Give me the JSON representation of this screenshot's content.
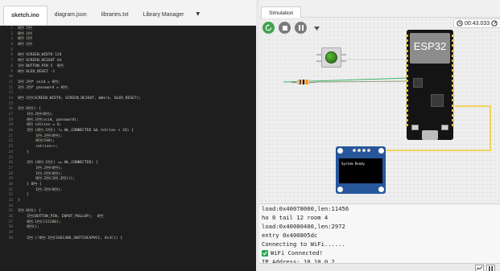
{
  "editor": {
    "tabs": [
      {
        "label": "sketch.ino",
        "active": true
      },
      {
        "label": "diagram.json",
        "active": false
      },
      {
        "label": "libraries.txt",
        "active": false
      },
      {
        "label": "Library Manager",
        "active": false
      }
    ],
    "tab_menu_icon": "caret-down-icon",
    "code_lines": [
      {
        "num": "1",
        "text": "#include <Wire.h>"
      },
      {
        "num": "2",
        "text": "#include <Adafruit_GFX.h>"
      },
      {
        "num": "3",
        "text": "#include <Adafruit_SSD1306.h>"
      },
      {
        "num": "4",
        "text": "#include <WiFi.h>"
      },
      {
        "num": "5",
        "text": ""
      },
      {
        "num": "6",
        "text": "#define SCREEN_WIDTH 128"
      },
      {
        "num": "7",
        "text": "#define SCREEN_HEIGHT 64"
      },
      {
        "num": "8",
        "text": "#define BUTTON_PIN 5  // GPIO pin for the push button"
      },
      {
        "num": "9",
        "text": "#define OLED_RESET -1"
      },
      {
        "num": "10",
        "text": ""
      },
      {
        "num": "11",
        "text": "const char* ssid = \"Wokwi-GUEST\";"
      },
      {
        "num": "12",
        "text": "const char* password = \"\";"
      },
      {
        "num": "13",
        "text": ""
      },
      {
        "num": "14",
        "text": "Adafruit_SSD1306 display(SCREEN_WIDTH, SCREEN_HEIGHT, &Wire, OLED_RESET);"
      },
      {
        "num": "15",
        "text": ""
      },
      {
        "num": "16",
        "text": "void connectWiFi() {"
      },
      {
        "num": "17",
        "text": "    Serial.print(\"Connecting to WiFi...\");"
      },
      {
        "num": "18",
        "text": "    WiFi.begin(ssid, password);"
      },
      {
        "num": "19",
        "text": "    int retries = 0;"
      },
      {
        "num": "20",
        "text": "    while (WiFi.status() != WL_CONNECTED && retries < 20) {"
      },
      {
        "num": "21",
        "text": "        Serial.print(\".\");"
      },
      {
        "num": "22",
        "text": "        delay(500);"
      },
      {
        "num": "23",
        "text": "        retries++;"
      },
      {
        "num": "24",
        "text": "    }"
      },
      {
        "num": "25",
        "text": ""
      },
      {
        "num": "26",
        "text": "    if (WiFi.status() == WL_CONNECTED) {"
      },
      {
        "num": "27",
        "text": "        Serial.println(\"\\nWiFi Connected!\");"
      },
      {
        "num": "28",
        "text": "        Serial.print(\"IP Address: \");"
      },
      {
        "num": "29",
        "text": "        Serial.println(WiFi.localIP());"
      },
      {
        "num": "30",
        "text": "    } else {"
      },
      {
        "num": "31",
        "text": "        Serial.println(\"\\n WiFi Connection Failed!\");"
      },
      {
        "num": "32",
        "text": "    }"
      },
      {
        "num": "33",
        "text": "}"
      },
      {
        "num": "34",
        "text": ""
      },
      {
        "num": "35",
        "text": "void setup() {"
      },
      {
        "num": "36",
        "text": "    pinMode(BUTTON_PIN, INPUT_PULLUP);  // Enable internal pull-up resistor"
      },
      {
        "num": "37",
        "text": "    Serial.begin(115200);"
      },
      {
        "num": "38",
        "text": "    connectWiFi();"
      },
      {
        "num": "39",
        "text": ""
      },
      {
        "num": "40",
        "text": "    if (!display.begin(SSD1306_SWITCHCAPVCC, 0x3C)) {"
      }
    ]
  },
  "simulation": {
    "tab_label": "Simulation",
    "controls": {
      "restart_icon": "restart-icon",
      "stop_icon": "stop-icon",
      "pause_icon": "pause-icon",
      "fast_forward_icon": "chevron-down-icon"
    },
    "timer": {
      "clock_icon": "clock-icon",
      "elapsed": "00:43.033",
      "speed_icon": "gauge-icon",
      "speed": "10"
    },
    "board_label": "ESP32",
    "oled_text": "System Ready",
    "colors": {
      "wire_green": "#3cb371",
      "wire_yellow": "#f4c20d",
      "oled_blue": "#27569b",
      "button_green": "#3d9b2a"
    }
  },
  "serial_monitor": {
    "lines": [
      {
        "text": "load:0x40078000,len:11456",
        "check": false
      },
      {
        "text": "ho 0 tail 12 room 4",
        "check": false
      },
      {
        "text": "load:0x40080400,len:2972",
        "check": false
      },
      {
        "text": "entry 0x400805dc",
        "check": false
      },
      {
        "text": "Connecting to WiFi......",
        "check": false
      },
      {
        "text": "WiFi Connected!",
        "check": true
      },
      {
        "text": "IP Address: 10.10.0.2",
        "check": false
      }
    ],
    "toolbar": {
      "graph_icon": "chart-icon",
      "pause_icon": "pause-icon"
    }
  }
}
